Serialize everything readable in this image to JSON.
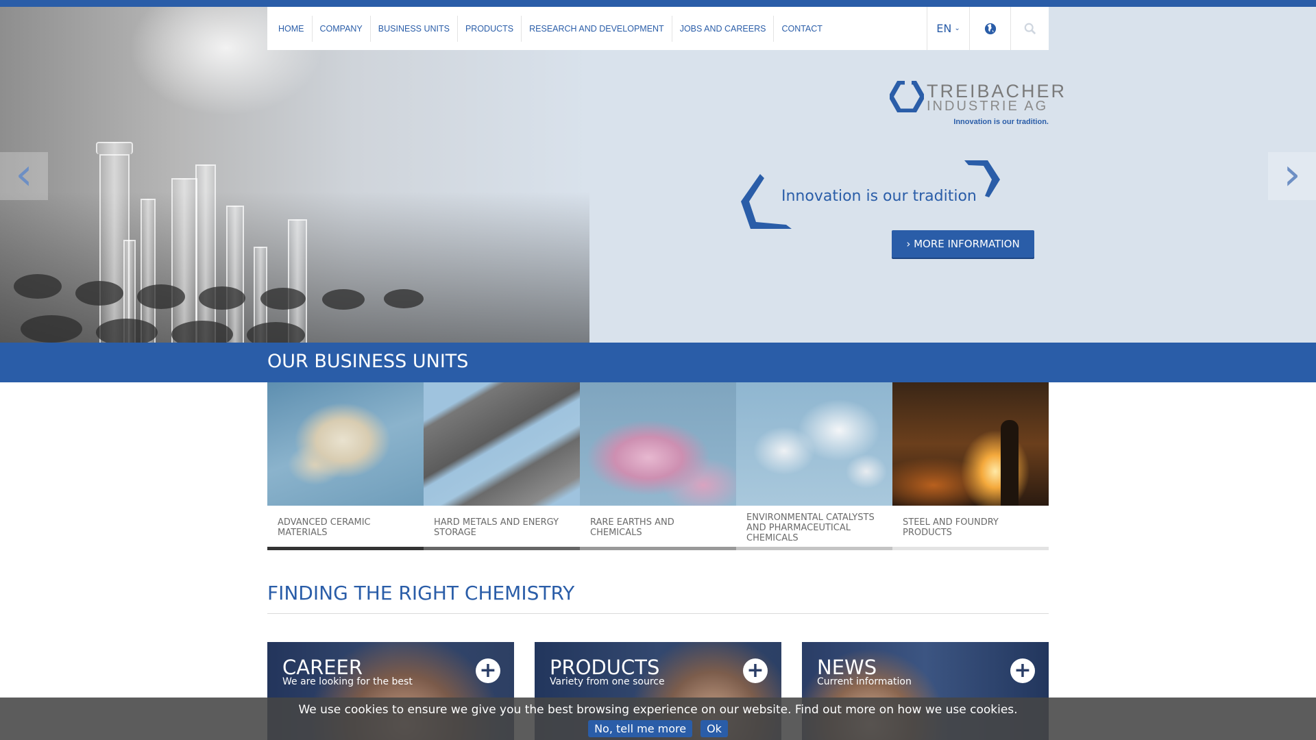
{
  "nav": {
    "items": [
      {
        "label": "HOME"
      },
      {
        "label": "COMPANY"
      },
      {
        "label": "BUSINESS UNITS"
      },
      {
        "label": "PRODUCTS"
      },
      {
        "label": "RESEARCH AND DEVELOPMENT"
      },
      {
        "label": "JOBS AND CAREERS"
      },
      {
        "label": "CONTACT"
      }
    ],
    "language": "EN",
    "globe_icon": "globe-icon",
    "search_icon": "search-icon"
  },
  "logo": {
    "line1": "TREIBACHER",
    "line2": "INDUSTRIE AG",
    "tagline": "Innovation is our tradition."
  },
  "hero": {
    "slogan": "Innovation is our tradition",
    "button_label": "MORE INFORMATION",
    "prev_icon": "chevron-left-icon",
    "next_icon": "chevron-right-icon"
  },
  "business_units": {
    "title": "OUR BUSINESS UNITS",
    "items": [
      {
        "label": "ADVANCED CERAMIC MATERIALS"
      },
      {
        "label": "HARD METALS AND ENERGY STORAGE"
      },
      {
        "label": "RARE EARTHS AND CHEMICALS"
      },
      {
        "label": "ENVIRONMENTAL CATALYSTS AND PHARMACEUTICAL CHEMICALS"
      },
      {
        "label": "STEEL AND FOUNDRY PRODUCTS"
      }
    ]
  },
  "finding": {
    "title": "FINDING THE RIGHT CHEMISTRY",
    "tiles": [
      {
        "title": "CAREER",
        "subtitle": "We are looking for the best"
      },
      {
        "title": "PRODUCTS",
        "subtitle": "Variety from one source"
      },
      {
        "title": "NEWS",
        "subtitle": "Current information"
      }
    ]
  },
  "cookie": {
    "text": "We use cookies to ensure we give you the best browsing experience on our website. Find out more on how we use cookies.",
    "more_label": "No, tell me more",
    "ok_label": "Ok"
  },
  "colors": {
    "brand_blue": "#2a5da8",
    "hero_bg": "#d9e2ec"
  }
}
